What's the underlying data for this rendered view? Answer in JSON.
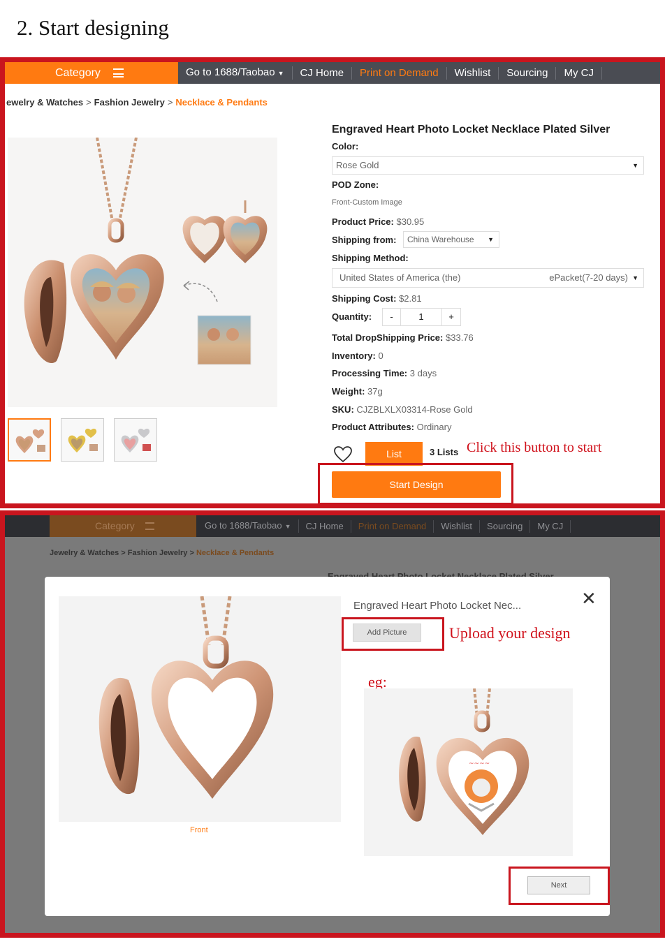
{
  "heading": "2. Start designing",
  "nav": {
    "category": "Category",
    "items": [
      "Go to 1688/Taobao",
      "CJ Home",
      "Print on Demand",
      "Wishlist",
      "Sourcing",
      "My CJ"
    ]
  },
  "breadcrumb": {
    "part1": "ewelry & Watches",
    "part2": "Fashion Jewelry",
    "current": "Necklace & Pendants",
    "sep": ">"
  },
  "product": {
    "title": "Engraved Heart Photo Locket Necklace Plated Silver",
    "color_label": "Color:",
    "color_value": "Rose Gold",
    "pod_label": "POD Zone:",
    "pod_value": "Front-Custom Image",
    "price_label": "Product Price:",
    "price_value": "$30.95",
    "ship_from_label": "Shipping from:",
    "ship_from_value": "China Warehouse",
    "ship_method_label": "Shipping Method:",
    "ship_method_country": "United States of America (the)",
    "ship_method_value": "ePacket(7-20 days)",
    "ship_cost_label": "Shipping Cost:",
    "ship_cost_value": "$2.81",
    "qty_label": "Quantity:",
    "qty_minus": "-",
    "qty_value": "1",
    "qty_plus": "+",
    "total_label": "Total DropShipping Price:",
    "total_value": "$33.76",
    "inventory_label": "Inventory:",
    "inventory_value": "0",
    "processing_label": "Processing Time:",
    "processing_value": "3 days",
    "weight_label": "Weight:",
    "weight_value": "37g",
    "sku_label": "SKU:",
    "sku_value": "CJZBLXLX03314-Rose Gold",
    "attr_label": "Product Attributes:",
    "attr_value": "Ordinary",
    "list_button": "List",
    "lists_count": "3 Lists",
    "start_button": "Start Design",
    "callout": "Click this button to start"
  },
  "panel2": {
    "category": "Category",
    "nav_items": [
      "Go to 1688/Taobao",
      "CJ Home",
      "Print on Demand",
      "Wishlist",
      "Sourcing",
      "My CJ"
    ],
    "breadcrumb_1": "Jewelry & Watches",
    "breadcrumb_2": "Fashion Jewelry",
    "breadcrumb_current": "Necklace & Pendants",
    "bg_title": "Engraved Heart Photo Locket Necklace Plated Silver",
    "modal": {
      "title": "Engraved Heart Photo Locket Nec...",
      "close": "✕",
      "add_picture": "Add Picture",
      "callout": "Upload your design",
      "eg": "eg:",
      "front_label": "Front",
      "next_button": "Next"
    }
  },
  "colors": {
    "accent": "#ff7a11",
    "highlight": "#c9151e",
    "nav_bg": "#4a4c53",
    "rose_gold": "#d9a98a"
  }
}
